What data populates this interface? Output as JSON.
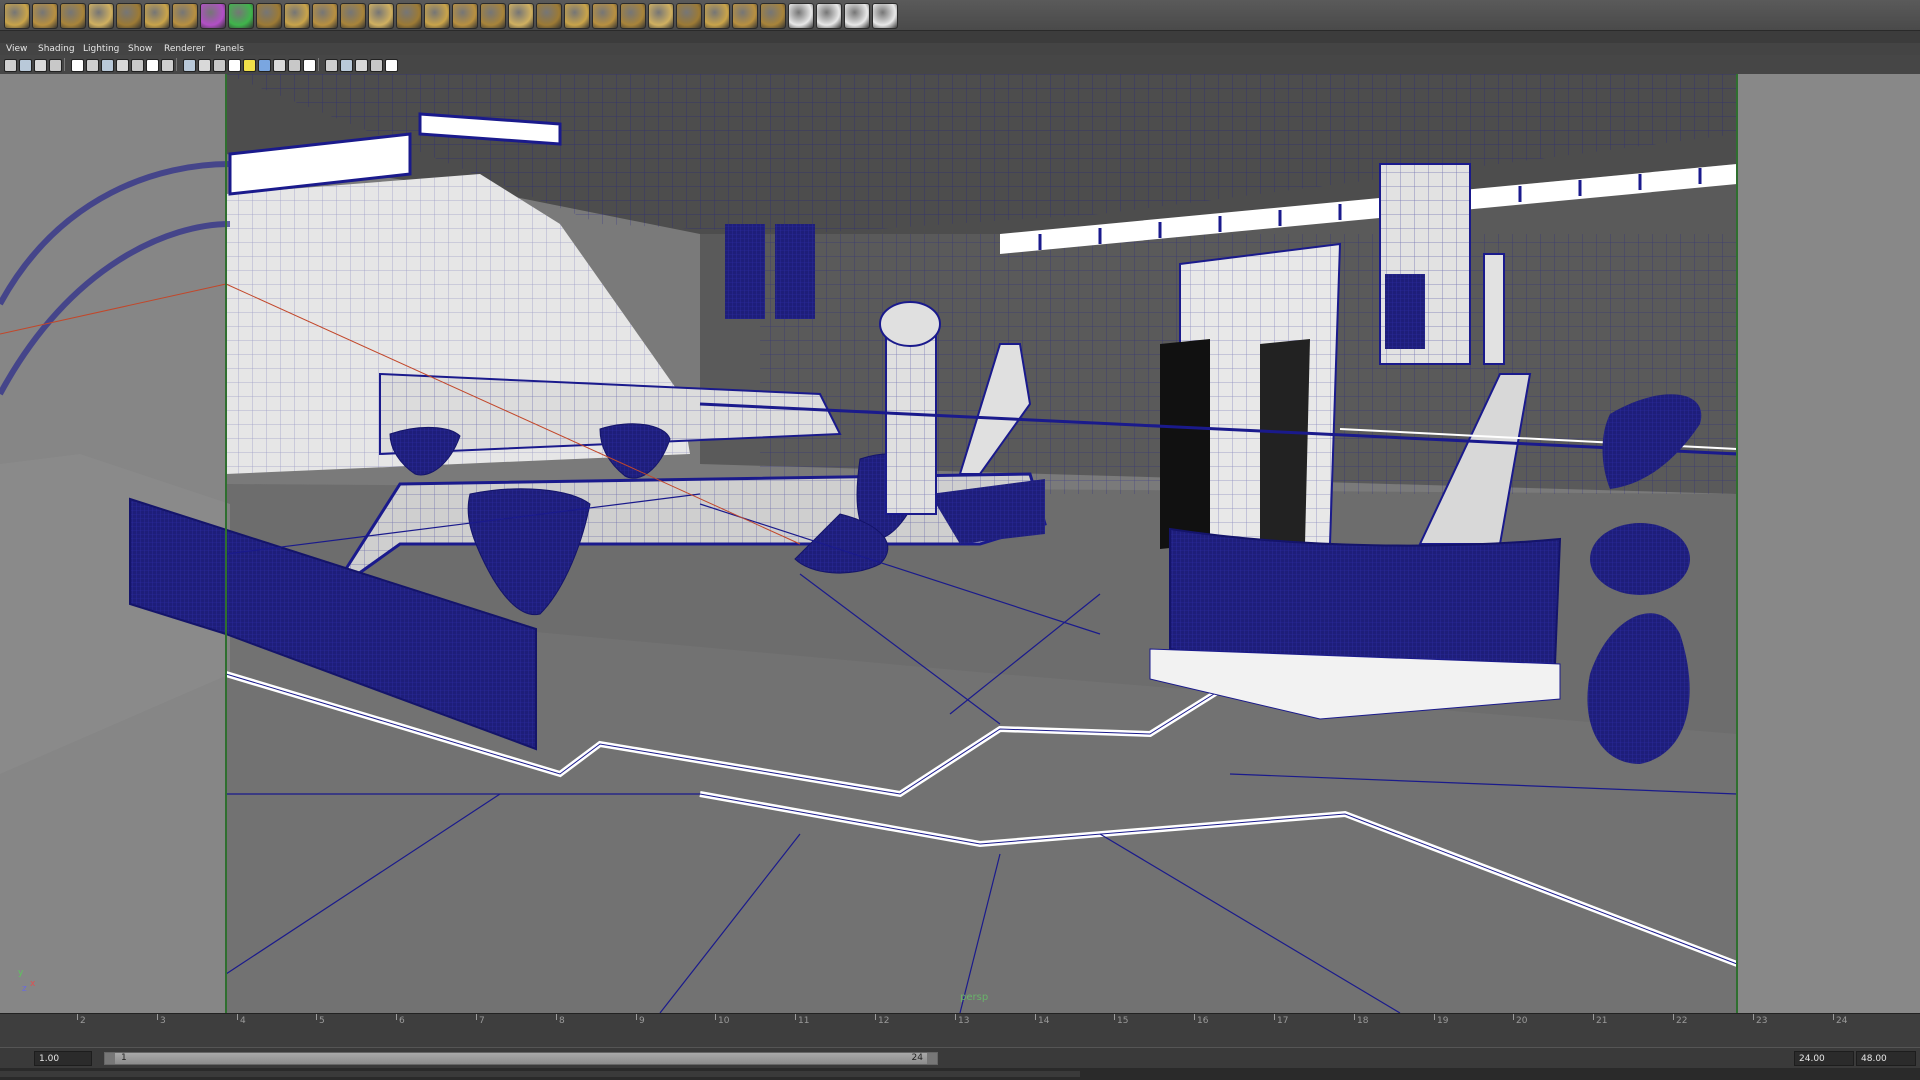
{
  "viewport_menu": {
    "items": [
      "View",
      "Shading",
      "Lighting",
      "Show",
      "Renderer",
      "Panels"
    ]
  },
  "viewport": {
    "camera": "persp",
    "axes": {
      "x": "x",
      "y": "y",
      "z": "z"
    }
  },
  "shelf": {
    "icons": [
      "poly-sphere-icon",
      "poly-cube-icon",
      "poly-cylinder-icon",
      "poly-cone-icon",
      "poly-plane-icon",
      "poly-torus-icon",
      "poly-pyramid-icon",
      "poly-pipe-icon",
      "soccer-ball-icon",
      "combine-icon",
      "separate-icon",
      "extract-icon",
      "smooth-icon",
      "booleans-icon",
      "mirror-icon",
      "extrude-icon",
      "bridge-icon",
      "append-polygon-icon",
      "fill-hole-icon",
      "split-polygon-icon",
      "bevel-icon",
      "insert-edge-loop-icon",
      "sculpt-icon",
      "planar-mapping-icon",
      "cylindrical-mapping-icon",
      "spherical-mapping-icon",
      "automatic-mapping-icon",
      "uv-editor-icon",
      "checker-map-icon",
      "layout-uvs-icon",
      "unfold-uvs-icon",
      "checker-icon"
    ],
    "accent_colors": {
      "gold": "#c9a44a",
      "purple": "#b24fc6",
      "green_highlight": "#3fb54b",
      "orange": "#d4792a"
    }
  },
  "panel_tools": {
    "icons": [
      "select-camera-icon",
      "camera-attributes-icon",
      "bookmarks-icon",
      "image-plane-icon",
      "grid-icon",
      "film-gate-icon",
      "resolution-gate-icon",
      "gate-mask-icon",
      "field-chart-icon",
      "safe-action-icon",
      "safe-title-icon",
      "wireframe-icon",
      "smooth-shade-icon",
      "wireframe-on-shaded-icon",
      "textured-icon",
      "use-all-lights-icon",
      "shadows-icon",
      "screen-space-ao-icon",
      "motion-blur-icon",
      "anti-aliasing-icon",
      "depth-of-field-icon",
      "isolate-select-icon",
      "xray-icon",
      "xray-joints-icon",
      "backface-culling-icon"
    ]
  },
  "time_slider": {
    "frame_labels": [
      "2",
      "3",
      "4",
      "5",
      "6",
      "7",
      "8",
      "9",
      "10",
      "11",
      "12",
      "13",
      "14",
      "15",
      "16",
      "17",
      "18",
      "19",
      "20",
      "21",
      "22",
      "23",
      "24"
    ]
  },
  "range_slider": {
    "start_time": "1.00",
    "range_start": "1",
    "range_end": "24",
    "end_time": "24.00",
    "max_time": "48.00"
  },
  "colors": {
    "wireframe": "#1a1a8c",
    "gate_line": "#2f6f2f",
    "background": "#7e7e7e",
    "ui_dark": "#444444"
  }
}
